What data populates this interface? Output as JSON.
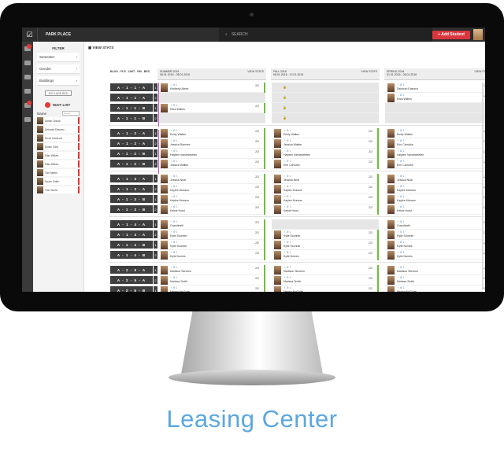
{
  "header": {
    "property": "PARK PLACE",
    "search_placeholder": "SEARCH",
    "add_button": "+ Add Student"
  },
  "filter": {
    "title": "FILTER",
    "items": [
      "Semester",
      "Gender",
      "Buildings"
    ],
    "exclude_label": "EXCLUDE BED"
  },
  "waitlist": {
    "title": "WAIT LIST",
    "name_label": "Name",
    "name_placeholder": "Name",
    "people": [
      "Adrian Oduda",
      "Deborah Easomo",
      "Devin Hasliome",
      "Dustin Cline",
      "Elias Wilkes",
      "Elias Wilkes",
      "Tom Martin",
      "Nicole Smith",
      "Tran Sachs"
    ]
  },
  "main": {
    "view_stats": "VIEW STATS",
    "unit_header": "BLDG - FLR - UNIT - RM - BED",
    "semesters": [
      {
        "name": "SUMMER 2016",
        "dates": "06.01.2016 - 08.01.2016",
        "stats": "VIEW STATS"
      },
      {
        "name": "FALL 2016",
        "dates": "08.01.2016 - 12.01.2016",
        "stats": "VIEW STATS"
      },
      {
        "name": "SPRING 2016",
        "dates": "01.01.2016 - 05.01.2016",
        "stats": "VIEW STATS"
      }
    ],
    "units": [
      {
        "code": "A - 1 - 1 - A",
        "n": "1"
      },
      {
        "code": "A - 1 - 1 - A",
        "n": "2"
      },
      {
        "code": "A - 1 - 1 - B",
        "n": "1"
      },
      {
        "code": "A - 1 - 1 - B",
        "n": "2"
      },
      {
        "code": "A - 1 - 2 - A",
        "n": "1"
      },
      {
        "code": "A - 1 - 2 - A",
        "n": "2"
      },
      {
        "code": "A - 1 - 2 - B",
        "n": "1"
      },
      {
        "code": "A - 1 - 2 - B",
        "n": "2"
      },
      {
        "code": "A - 1 - 3 - A",
        "n": "1"
      },
      {
        "code": "A - 1 - 3 - A",
        "n": "2"
      },
      {
        "code": "A - 1 - 3 - B",
        "n": "1"
      },
      {
        "code": "A - 1 - 3 - B",
        "n": "2"
      },
      {
        "code": "A - 1 - 4 - A",
        "n": "1"
      },
      {
        "code": "A - 1 - 4 - A",
        "n": "2"
      },
      {
        "code": "A - 1 - 4 - B",
        "n": "1"
      },
      {
        "code": "A - 1 - 4 - B",
        "n": "2"
      },
      {
        "code": "A - 2 - 5 - A",
        "n": "1"
      },
      {
        "code": "A - 2 - 5 - A",
        "n": "2"
      },
      {
        "code": "A - 2 - 5 - B",
        "n": "1"
      }
    ],
    "col1": [
      "Kimberly Allred",
      "",
      "Eliza Wilkes",
      "",
      "Emily Walker",
      "Jessica Ramirez",
      "Hayden Vandeweeten",
      "Jessica Walker",
      "Jessica Neal",
      "Kaylee Munson",
      "Kaylee Munson",
      "Kelsie Hurst",
      "Guardinelli",
      "Kylie Sconnie",
      "Kylie Sconnie",
      "Kylie Nomes",
      "Madison Stevens",
      "Marissa Smith",
      "Megan McGuire"
    ],
    "col2": [
      "",
      "",
      "",
      "",
      "Emily Walker",
      "Jessica Walker",
      "Hayden Vandeweeten",
      "Erin Carruths",
      "Jessica Neal",
      "Kaylee Munson",
      "Kaylee Munson",
      "Kelsie Hurst",
      "",
      "Kylie Sconnie",
      "Kylie Sconnie",
      "Kylie Nomes",
      "Madison Stevens",
      "Marissa Smith",
      "Megan McGuire"
    ],
    "col3": [
      "Deborah Easomo",
      "Eliza Wilkes",
      "",
      "",
      "Emily Walker",
      "Erin Carruths",
      "Hayden Vandeweeten",
      "Erin Carruths",
      "Jessica Neal",
      "Kaylee Munson",
      "Kaylee Munson",
      "Kelsie Hurst",
      "Guardinelli",
      "Kylie Sconnie",
      "Kylie Nomes",
      "Kylie Nomes",
      "Madison Stevens",
      "Marissa Smith",
      "Megan McGuire"
    ],
    "slot_meta": "2/2",
    "slot_icons": "♀ ⚙ 1",
    "lock_icon": "🔒"
  },
  "caption": "Leasing Center",
  "colors": {
    "accent": "#d9363e",
    "green": "#6bbf3a",
    "magenta": "#c552c5",
    "caption": "#5ba7de"
  }
}
